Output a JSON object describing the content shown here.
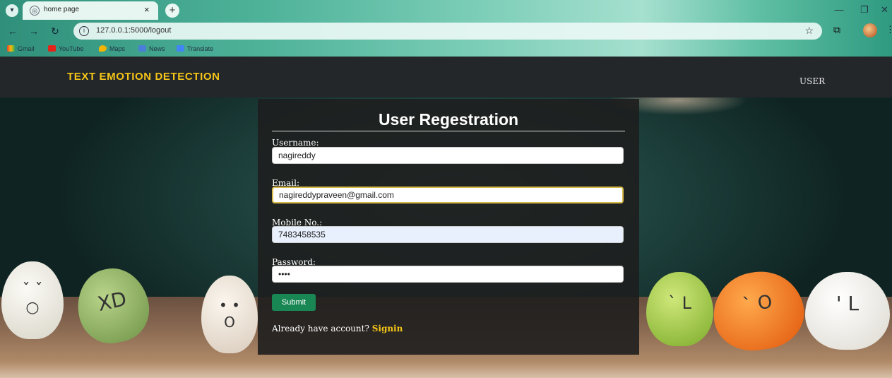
{
  "browser": {
    "tab_title": "home page",
    "url": "127.0.0.1:5000/logout",
    "bookmarks": [
      "Gmail",
      "YouTube",
      "Maps",
      "News",
      "Translate"
    ]
  },
  "site": {
    "brand": "TEXT EMOTION DETECTION",
    "nav_user": "USER"
  },
  "form": {
    "title": "User Regestration",
    "fields": [
      {
        "label": "Username:",
        "value": "nagireddy"
      },
      {
        "label": "Email:",
        "value": "nagireddypraveen@gmail.com"
      },
      {
        "label": "Mobile No.:",
        "value": "7483458535"
      },
      {
        "label": "Password:",
        "value": "••••"
      }
    ],
    "submit_label": "Submit",
    "account_prompt": "Already have account?",
    "signin_label": "Signin"
  },
  "colors": {
    "brand": "#f5c518",
    "submit": "#198754",
    "navbar": "#24272a"
  }
}
